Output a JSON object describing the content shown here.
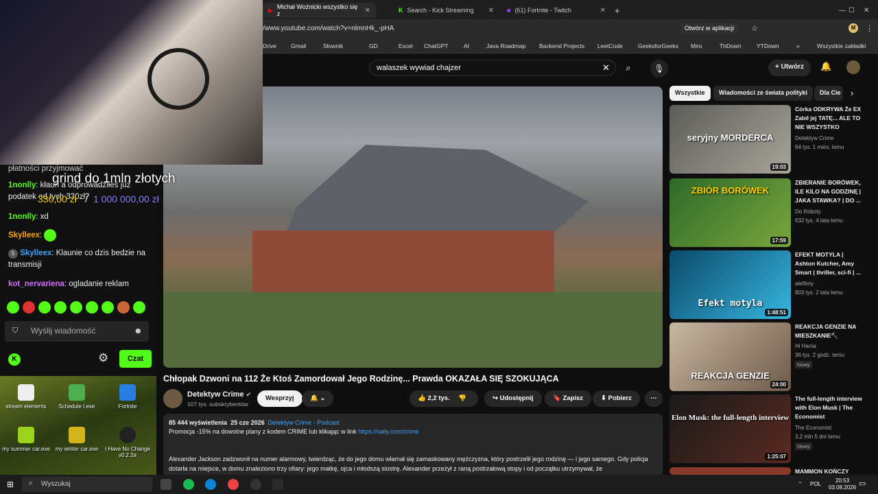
{
  "browser": {
    "tabs": [
      {
        "label": "Michał Woźnicki wszystko się z"
      },
      {
        "label": "Search - Kick Streaming"
      },
      {
        "label": "(61) Fortnite - Twitch"
      }
    ],
    "url": "/www.youtube.com/watch?v=nlmnHk_-pHA",
    "open_app": "Otwórz w aplikacji",
    "bookmarks": [
      "Drive",
      "Gmail",
      "Słownik",
      "GD",
      "Excel",
      "ChatGPT",
      "AI",
      "Java Roadmap",
      "Backend Projects",
      "LeetCode",
      "GeeksforGeeks",
      "Miro",
      "ThDown",
      "YTDown"
    ],
    "all_bookmarks": "Wszystkie zakładki"
  },
  "youtube": {
    "search_value": "walaszek wywiad chajzer",
    "create_label": "Utwórz",
    "video_title": "Chłopak Dzwoni na 112 Że Ktoś Zamordował Jego Rodzinę... Prawda OKAZAŁA SIĘ SZOKUJĄCA",
    "channel_name": "Detektyw Crime",
    "channel_subs": "107 tys. subskrybentów",
    "support_label": "Wesprzyj",
    "likes": "2,2 tys.",
    "share_label": "Udostępnij",
    "save_label": "Zapisz",
    "download_label": "Pobierz",
    "desc_views": "85 444 wyświetlenia",
    "desc_date": "25 cze 2026",
    "desc_channel": "Detektyw Crime - Podcast",
    "desc_promo": "Promocja -15% na dowolne plany z kodem CRIME lub klikając w link",
    "desc_link": "https://saily.com/crime",
    "desc_body": "Alexander Jackson zadzwonił na numer alarmowy, twierdząc, że do jego domu włamał się zamaskowany mężczyzna, który postrzelił jego rodzinę — i jego samego. Gdy policja dotarła na miejsce, w domu znaleziono trzy ofiary: jego matkę, ojca i młodszą siostrę. Alexander przeżył z raną postrzałową stopy i od początku utrzymywał, że",
    "chips": [
      "Wszystkie",
      "Wiadomości ze świata polityki",
      "Dla Cie"
    ],
    "recs": [
      {
        "title": "Córka ODKRYWA Że EX Zabił jej TATĘ... ALE TO NIE WSZYSTKO",
        "channel": "Detektyw Crime",
        "meta": "64 tys.   1 mies. temu",
        "duration": "19:03",
        "thumb_text": "seryjny MORDERCA",
        "new": ""
      },
      {
        "title": "ZBIERANIE BORÓWEK, ILE KILO NA GODZINĘ | JAKA STAWKA? | DO ...",
        "channel": "Do Roboty",
        "meta": "632 tys.   4 lata temu",
        "duration": "17:59",
        "thumb_text": "ZBIÓR BORÓWEK",
        "new": ""
      },
      {
        "title": "EFEKT MOTYLA | Ashton Kutcher, Amy Smart | thriller, sci-fi | ...",
        "channel": "alefilmy",
        "meta": "803 tys.   2 lata temu",
        "duration": "1:48:51",
        "thumb_text": "Efekt motyla",
        "new": ""
      },
      {
        "title": "REAKCJA GENZIE NA MIESZKANIE🔨",
        "channel": "Hi Hania",
        "meta": "36 tys.   2 godz. temu",
        "duration": "24:00",
        "thumb_text": "REAKCJA GENZIE",
        "new": "Nowy"
      },
      {
        "title": "The full-length interview with Elon Musk | The Economist",
        "channel": "The Economist",
        "meta": "3,2 mln   5 dni temu",
        "duration": "1:25:07",
        "thumb_text": "Elon Musk: the full-length interview",
        "new": "Nowy"
      },
      {
        "title": "MAMMON KOŃCZY",
        "channel": "",
        "meta": "",
        "duration": "",
        "thumb_text": "",
        "new": ""
      }
    ]
  },
  "stream": {
    "grind_text": "grind do 1mln złotych",
    "amount": "330,00 zł",
    "amount_sep": "/",
    "goal": "1 000 000,00 zł",
    "percent": "(0.03%)"
  },
  "chat": {
    "messages": [
      {
        "user": "",
        "text": "płatności przyjmować"
      },
      {
        "user": "1nonlly",
        "text": "kłaun a odprowadziłeś już podatek od tych 330zł?"
      },
      {
        "user": "1nonlly",
        "text": "xd"
      },
      {
        "user": "Skylleex",
        "text": ""
      },
      {
        "user": "Skylleex",
        "text": "Klaunie co dzis bedzie na transmisji"
      },
      {
        "user": "kot_nervariena",
        "text": "ogladanie reklam"
      }
    ],
    "input_placeholder": "Wyślij wiadomość",
    "send_label": "Czat"
  },
  "desktop": {
    "icons": [
      "stream elements",
      "Schedule I.exe",
      "Fortnite",
      "my summer car.exe",
      "my winter car.exe",
      "I Have No Change v0.2.2a"
    ]
  },
  "taskbar": {
    "search_placeholder": "Wyszukaj",
    "lang": "POL",
    "time": "20:53",
    "date": "03.08.2026"
  },
  "colors": {
    "kick_green": "#53fc18",
    "yt_bg": "#0f0f0f",
    "link": "#3ea6ff"
  }
}
